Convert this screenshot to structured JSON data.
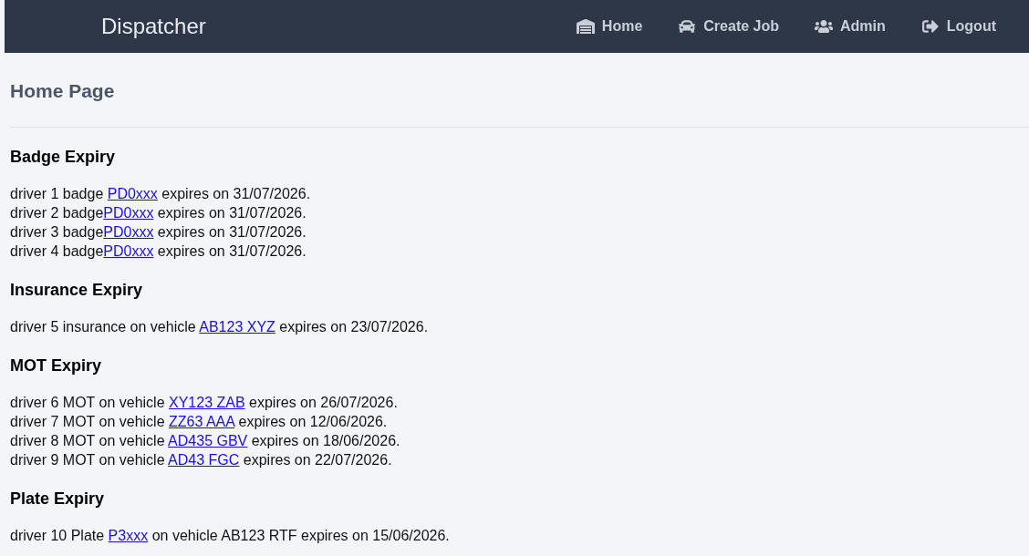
{
  "navbar": {
    "brand": "Dispatcher",
    "links": [
      {
        "label": "Home"
      },
      {
        "label": "Create Job"
      },
      {
        "label": "Admin"
      },
      {
        "label": "Logout"
      }
    ]
  },
  "page_title": "Home Page",
  "sections": [
    {
      "title": "Badge Expiry",
      "notices": [
        {
          "before": "driver 1 badge ",
          "link": "PD0xxx",
          "after": " expires on 31/07/2026."
        },
        {
          "before": "driver 2 badge",
          "link": "PD0xxx",
          "after": " expires on 31/07/2026."
        },
        {
          "before": "driver 3 badge",
          "link": "PD0xxx",
          "after": " expires on 31/07/2026."
        },
        {
          "before": "driver 4 badge",
          "link": "PD0xxx",
          "after": " expires on 31/07/2026."
        }
      ]
    },
    {
      "title": "Insurance Expiry",
      "notices": [
        {
          "before": "driver 5 insurance on vehicle ",
          "link": "AB123 XYZ",
          "after": " expires on 23/07/2026."
        }
      ]
    },
    {
      "title": "MOT Expiry",
      "notices": [
        {
          "before": "driver 6 MOT on vehicle ",
          "link": "XY123 ZAB",
          "after": " expires on 26/07/2026."
        },
        {
          "before": "driver 7 MOT on vehicle ",
          "link": "ZZ63 AAA",
          "after": " expires on 12/06/2026."
        },
        {
          "before": "driver 8 MOT on vehicle ",
          "link": "AD435 GBV",
          "after": " expires on 18/06/2026."
        },
        {
          "before": "driver 9 MOT on vehicle ",
          "link": "AD43 FGC",
          "after": " expires on 22/07/2026."
        }
      ]
    },
    {
      "title": "Plate Expiry",
      "notices": [
        {
          "before": "driver 10 Plate ",
          "link": "P3xxx",
          "after": " on vehicle AB123 RTF expires on 15/06/2026."
        }
      ]
    }
  ]
}
